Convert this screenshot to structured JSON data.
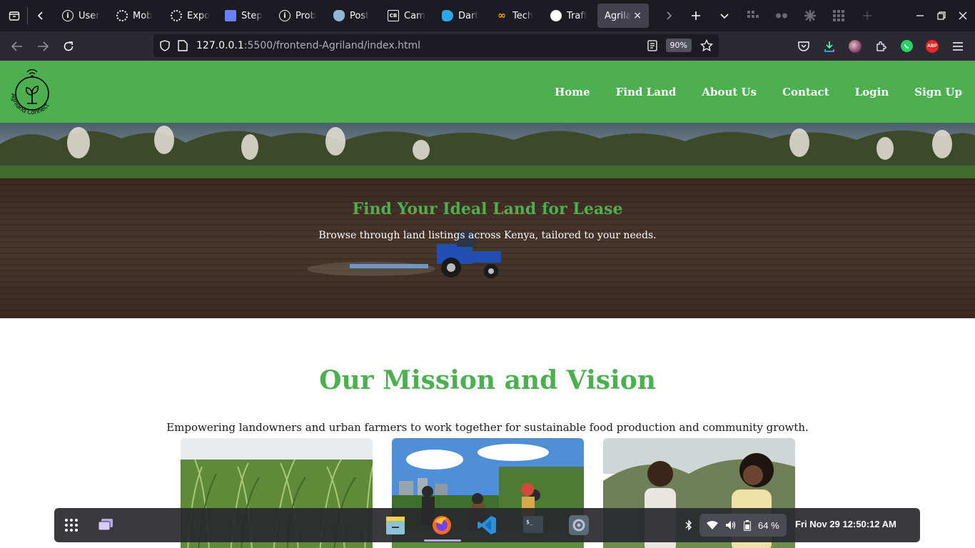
{
  "browser": {
    "tabs": [
      {
        "label": "User",
        "icon": "info-icon"
      },
      {
        "label": "Mob",
        "icon": "openai-icon"
      },
      {
        "label": "Expo",
        "icon": "openai-icon"
      },
      {
        "label": "Step",
        "icon": "gift-icon"
      },
      {
        "label": "Prob",
        "icon": "info-icon"
      },
      {
        "label": "Post",
        "icon": "postgres-icon"
      },
      {
        "label": "Cam",
        "icon": "camera-card-icon"
      },
      {
        "label": "Dart",
        "icon": "dart-icon"
      },
      {
        "label": "Tech",
        "icon": "infinity-icon"
      },
      {
        "label": "Traff",
        "icon": "github-icon"
      }
    ],
    "active_tab": {
      "label": "Agrila",
      "close": "×"
    },
    "url_host": "127.0.0.1",
    "url_path": ":5500/frontend-Agriland/index.html",
    "zoom": "90%",
    "extension_badge": "ABP"
  },
  "site": {
    "logo_text": "Agriland Connect",
    "nav": [
      "Home",
      "Find Land",
      "About Us",
      "Contact",
      "Login",
      "Sign Up"
    ],
    "hero_title": "Find Your Ideal Land for Lease",
    "hero_subtitle": "Browse through land listings across Kenya, tailored to your needs.",
    "mission_title": "Our Mission and Vision",
    "mission_text": "Empowering landowners and urban farmers to work together for sustainable food production and community growth."
  },
  "dock": {
    "apps": [
      "files-icon",
      "firefox-icon",
      "vscode-icon",
      "terminal-icon",
      "settings-icon"
    ],
    "battery": "64 %",
    "datetime": "Fri Nov 29  12:50:12 AM"
  },
  "colors": {
    "brand_green": "#4caf50",
    "tab_bar": "#1c1b22",
    "toolbar": "#2b2a33",
    "dock": "#28282e"
  }
}
